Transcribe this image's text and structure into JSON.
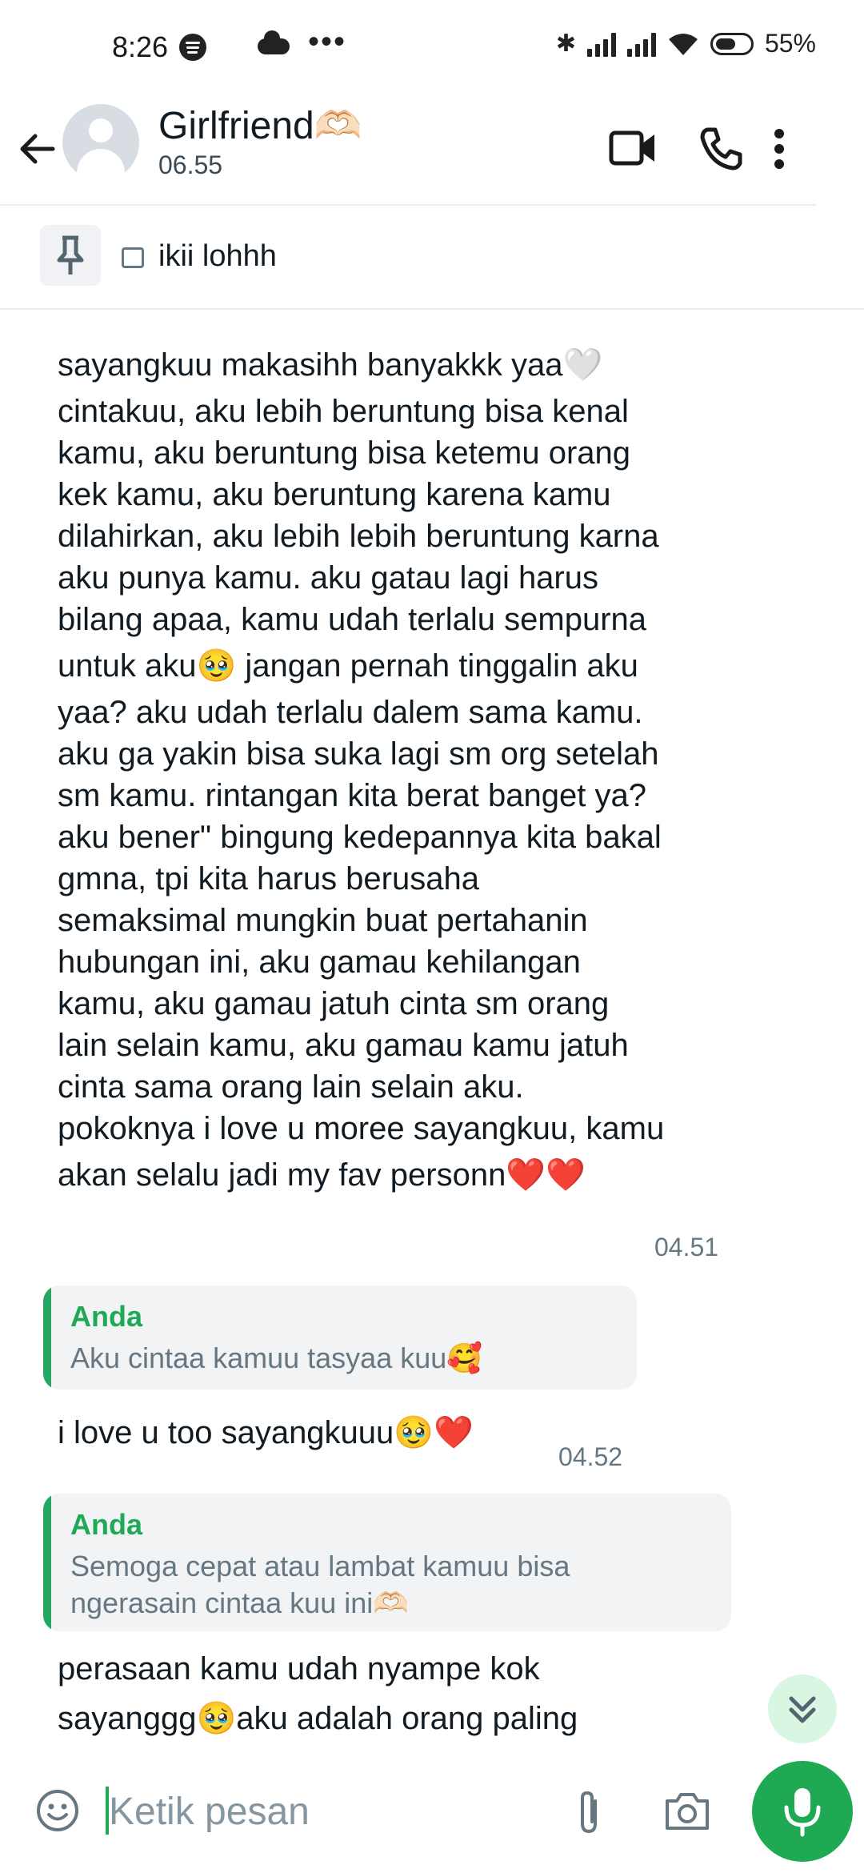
{
  "status_bar": {
    "time": "8:26",
    "battery": "55%"
  },
  "header": {
    "contact_name": "Girlfriend🫶🏻",
    "last_seen": "06.55"
  },
  "pinned": {
    "text": "ikii lohhh"
  },
  "messages": {
    "long_message": {
      "lines": [
        "sayangkuu makasihh banyakkk yaa🤍",
        "cintakuu, aku lebih beruntung bisa kenal",
        "kamu, aku beruntung bisa ketemu orang",
        "kek kamu, aku beruntung karena kamu",
        "dilahirkan, aku lebih lebih beruntung karna",
        "aku punya kamu. aku gatau lagi harus",
        "bilang apaa, kamu udah terlalu sempurna",
        "untuk aku🥹 jangan pernah tinggalin aku",
        "yaa? aku udah terlalu dalem sama kamu.",
        "aku ga yakin bisa suka lagi sm org setelah",
        "sm kamu. rintangan kita berat banget ya?",
        "aku bener\" bingung kedepannya kita bakal",
        "gmna, tpi kita harus berusaha",
        "semaksimal mungkin buat pertahanin",
        "hubungan ini, aku gamau kehilangan",
        "kamu, aku gamau jatuh cinta sm orang",
        "lain selain kamu, aku gamau kamu jatuh",
        "cinta sama orang lain selain aku.",
        "pokoknya i love u moree sayangkuu, kamu",
        "akan selalu jadi my fav personn❤️❤️"
      ],
      "time": "04.51"
    },
    "reply1": {
      "quote_name": "Anda",
      "quote_text": "Aku cintaa kamuu tasyaa kuu🥰",
      "text": "i love u too sayangkuuu🥹❤️",
      "time": "04.52"
    },
    "reply2": {
      "quote_name": "Anda",
      "quote_lines": [
        "Semoga cepat atau lambat kamuu bisa",
        "ngerasain cintaa kuu ini🫶🏻"
      ],
      "lines": [
        "perasaan kamu udah nyampe kok",
        "sayanggg🥹aku adalah orang paling"
      ]
    }
  },
  "input": {
    "placeholder": "Ketik pesan"
  },
  "colors": {
    "accent": "#1ea952",
    "quote_bg": "#f1f3f4",
    "muted": "#667781"
  },
  "icons": [
    "back-arrow-icon",
    "video-call-icon",
    "phone-icon",
    "more-vert-icon",
    "pin-icon",
    "image-icon",
    "chevrons-down-icon",
    "emoji-icon",
    "attach-icon",
    "camera-icon",
    "mic-icon"
  ]
}
